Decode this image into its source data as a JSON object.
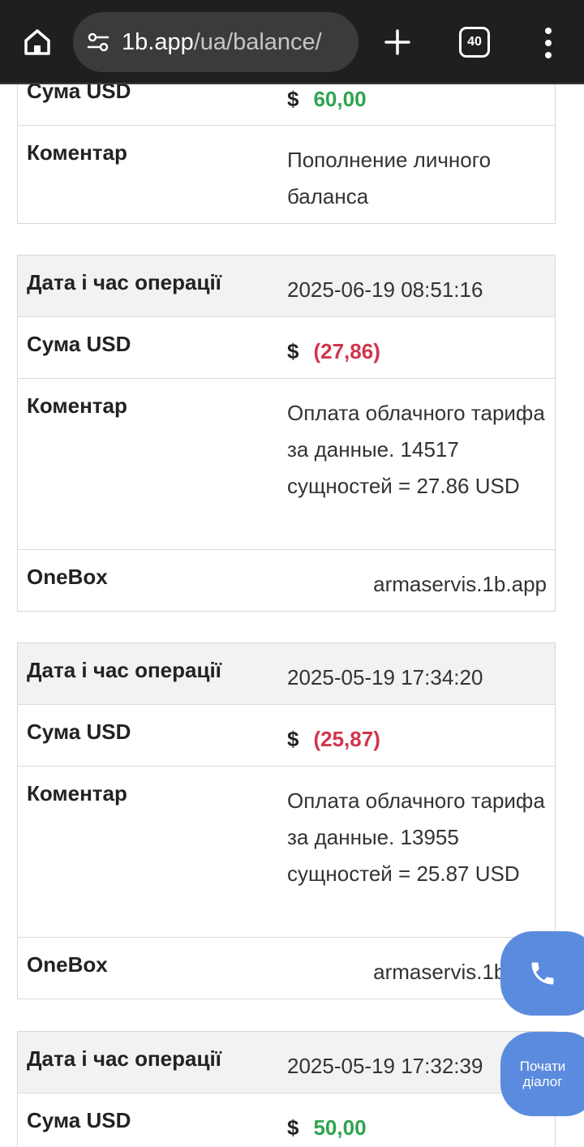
{
  "browser": {
    "url_host": "1b.app",
    "url_path": "/ua/balance/",
    "tab_count": "40"
  },
  "labels": {
    "datetime": "Дата і час операції",
    "amount": "Сума USD",
    "comment": "Коментар",
    "onebox": "OneBox",
    "currency": "$"
  },
  "records": [
    {
      "amount": "60,00",
      "comment": "Пополнение личного баланса"
    },
    {
      "datetime": "2025-06-19 08:51:16",
      "amount": "(27,86)",
      "comment": "Оплата облачного тарифа за данные. 14517 сущностей = 27.86 USD",
      "onebox": "armaservis.1b.app"
    },
    {
      "datetime": "2025-05-19 17:34:20",
      "amount": "(25,87)",
      "comment": "Оплата облачного тарифа за данные. 13955 сущностей = 25.87 USD",
      "onebox": "armaservis.1b.app"
    },
    {
      "datetime": "2025-05-19 17:32:39",
      "amount": "50,00"
    }
  ],
  "floating": {
    "chat_label": "Почати діалог"
  },
  "colors": {
    "positive": "#2ea44f",
    "negative": "#d1364b",
    "fab": "#5b8bde"
  }
}
